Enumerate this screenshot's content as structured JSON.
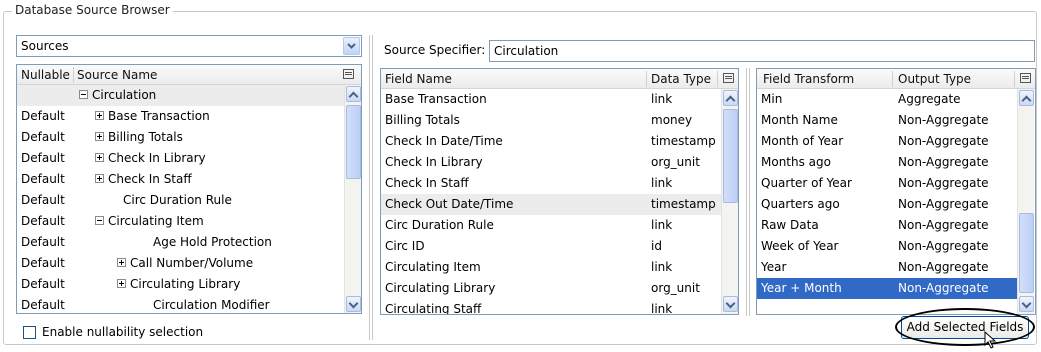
{
  "window": {
    "group_title": "Database Source Browser"
  },
  "sources": {
    "combo_value": "Sources",
    "headers": {
      "nullable": "Nullable",
      "name": "Source Name"
    },
    "rows": [
      {
        "nullable": "",
        "name": "Circulation",
        "toggle": "minus",
        "indent": 0
      },
      {
        "nullable": "Default",
        "name": "Base Transaction",
        "toggle": "plus",
        "indent": 1
      },
      {
        "nullable": "Default",
        "name": "Billing Totals",
        "toggle": "plus",
        "indent": 1
      },
      {
        "nullable": "Default",
        "name": "Check In Library",
        "toggle": "plus",
        "indent": 1
      },
      {
        "nullable": "Default",
        "name": "Check In Staff",
        "toggle": "plus",
        "indent": 1
      },
      {
        "nullable": "Default",
        "name": "Circ Duration Rule",
        "toggle": "",
        "indent": 1
      },
      {
        "nullable": "Default",
        "name": "Circulating Item",
        "toggle": "minus",
        "indent": 1
      },
      {
        "nullable": "Default",
        "name": "Age Hold Protection",
        "toggle": "",
        "indent": 2
      },
      {
        "nullable": "Default",
        "name": "Call Number/Volume",
        "toggle": "plus",
        "indent": 2
      },
      {
        "nullable": "Default",
        "name": "Circulating Library",
        "toggle": "plus",
        "indent": 2
      },
      {
        "nullable": "Default",
        "name": "Circulation Modifier",
        "toggle": "",
        "indent": 2
      }
    ],
    "nullability_label": "Enable nullability selection"
  },
  "fields": {
    "specifier_label": "Source Specifier:",
    "specifier_value": "Circulation",
    "headers": {
      "name": "Field Name",
      "type": "Data Type"
    },
    "rows": [
      {
        "name": "Base Transaction",
        "type": "link"
      },
      {
        "name": "Billing Totals",
        "type": "money"
      },
      {
        "name": "Check In Date/Time",
        "type": "timestamp"
      },
      {
        "name": "Check In Library",
        "type": "org_unit"
      },
      {
        "name": "Check In Staff",
        "type": "link"
      },
      {
        "name": "Check Out Date/Time",
        "type": "timestamp"
      },
      {
        "name": "Circ Duration Rule",
        "type": "link"
      },
      {
        "name": "Circ ID",
        "type": "id"
      },
      {
        "name": "Circulating Item",
        "type": "link"
      },
      {
        "name": "Circulating Library",
        "type": "org_unit"
      },
      {
        "name": "Circulating Staff",
        "type": "link"
      }
    ]
  },
  "transforms": {
    "headers": {
      "name": "Field Transform",
      "type": "Output Type"
    },
    "rows": [
      {
        "name": "Min",
        "type": "Aggregate"
      },
      {
        "name": "Month Name",
        "type": "Non-Aggregate"
      },
      {
        "name": "Month of Year",
        "type": "Non-Aggregate"
      },
      {
        "name": "Months ago",
        "type": "Non-Aggregate"
      },
      {
        "name": "Quarter of Year",
        "type": "Non-Aggregate"
      },
      {
        "name": "Quarters ago",
        "type": "Non-Aggregate"
      },
      {
        "name": "Raw Data",
        "type": "Non-Aggregate"
      },
      {
        "name": "Week of Year",
        "type": "Non-Aggregate"
      },
      {
        "name": "Year",
        "type": "Non-Aggregate"
      },
      {
        "name": "Year + Month",
        "type": "Non-Aggregate"
      }
    ],
    "add_button": "Add Selected Fields"
  },
  "colors": {
    "selection": "#3169c6",
    "border": "#7f9db9"
  }
}
